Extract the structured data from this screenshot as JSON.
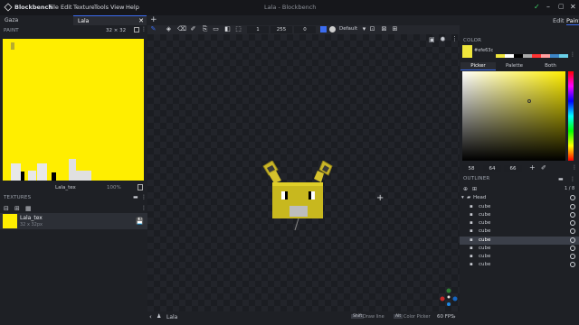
{
  "app": {
    "title": "Blockbench",
    "window_title": "Lala - Blockbench"
  },
  "menu": [
    "File",
    "Edit",
    "Texture",
    "Tools",
    "View",
    "Help"
  ],
  "tabs": [
    {
      "label": "Gaza"
    },
    {
      "label": "Lala"
    }
  ],
  "mode_tabs": {
    "edit": "Edit",
    "paint": "Paint"
  },
  "toolbar": {
    "value1": "1",
    "value2": "255",
    "value3": "0",
    "brush_mode": "Default"
  },
  "paint_panel": {
    "header": "PAINT",
    "size": "32 × 32",
    "texture_name": "Lala_tex",
    "zoom": "100%"
  },
  "textures_panel": {
    "header": "TEXTURES",
    "item_name": "Lala_tex",
    "item_subtitle": "32 x 32px"
  },
  "color_panel": {
    "header": "COLOR",
    "hex": "#efe63c",
    "tabs": [
      "Picker",
      "Palette",
      "Both"
    ],
    "h": "58",
    "s": "64",
    "v": "66",
    "palette_colors": [
      "#efe63c",
      "#ffffff",
      "#000000",
      "#aaaaaa",
      "#ff3333",
      "#ffa0a0",
      "#3d85c6",
      "#6ad0e8"
    ]
  },
  "outliner": {
    "header": "OUTLINER",
    "count": "1 / 8",
    "group": "Head",
    "items": [
      "cube",
      "cube",
      "cube",
      "cube",
      "cube",
      "cube",
      "cube",
      "cube"
    ]
  },
  "status": {
    "name": "Lala",
    "hint1_key": "Shift",
    "hint1": "Draw line",
    "hint2_key": "Alt",
    "hint2": "Color Picker",
    "fps": "60 FPS"
  },
  "colors": {
    "accent": "#3b6cf0",
    "yellow": "#ffee00",
    "selected_row": "#3b3f49"
  }
}
